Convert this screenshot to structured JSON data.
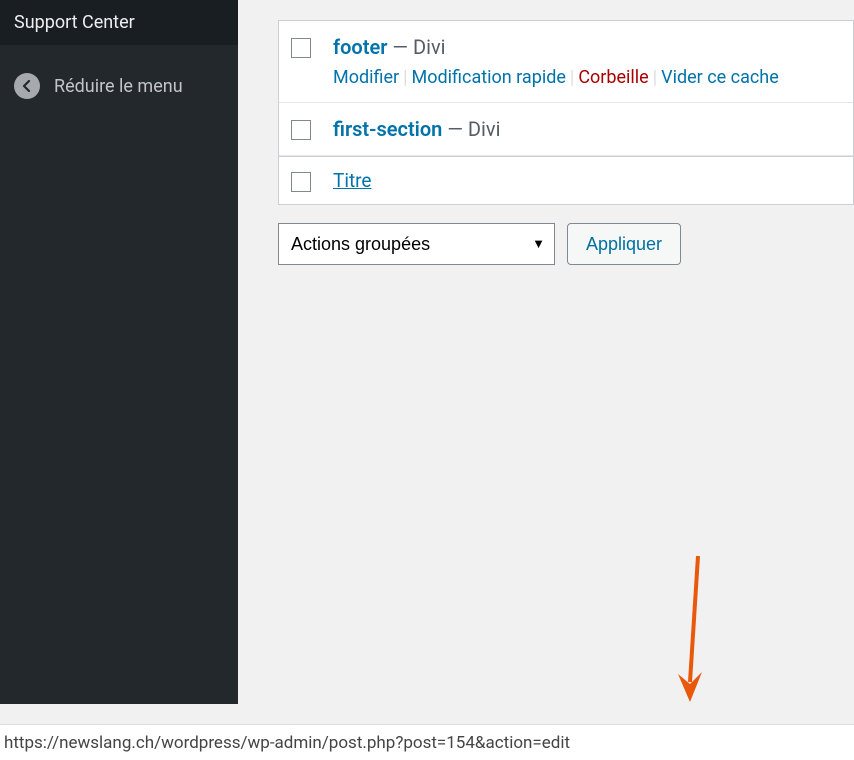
{
  "sidebar": {
    "support_label": "Support Center",
    "collapse_label": "Réduire le menu"
  },
  "table": {
    "rows": [
      {
        "title": "footer",
        "suffix": " — Divi",
        "actions": {
          "edit": "Modifier",
          "quick_edit": "Modification rapide",
          "trash": "Corbeille",
          "clear_cache": "Vider ce cache"
        }
      },
      {
        "title": "first-section",
        "suffix": " — Divi"
      }
    ],
    "header": "Titre"
  },
  "bulk": {
    "select_placeholder": "Actions groupées",
    "apply": "Appliquer"
  },
  "status_url": "https://newslang.ch/wordpress/wp-admin/post.php?post=154&action=edit"
}
